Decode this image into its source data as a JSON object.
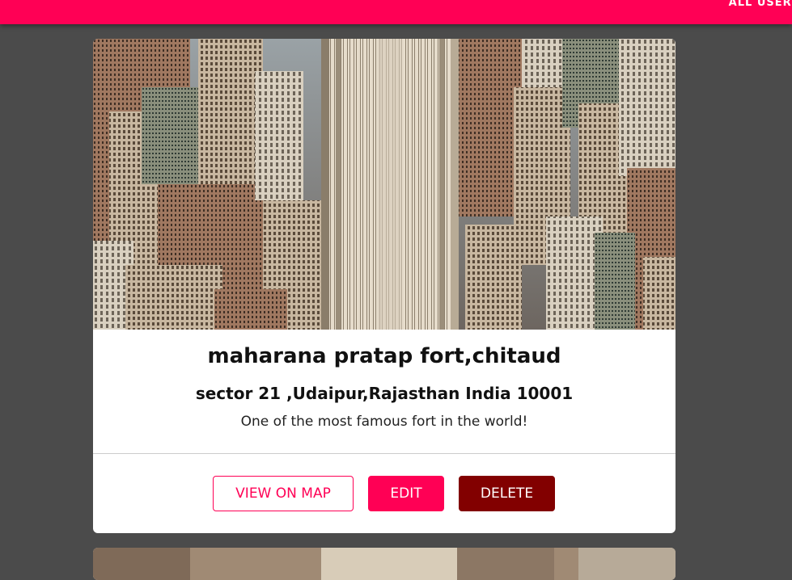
{
  "header": {
    "nav_link_label": "ALL USERS"
  },
  "place": {
    "title": "maharana pratap fort,chitaud",
    "address": "sector 21 ,Udaipur,Rajasthan India 10001",
    "description": "One of the most famous fort in the world!",
    "actions": {
      "view_on_map": "VIEW ON MAP",
      "edit": "EDIT",
      "delete": "DELETE"
    }
  },
  "colors": {
    "accent": "#ff0055",
    "danger": "#820000",
    "background": "#4b4b4b",
    "card": "#ffffff"
  },
  "icons": {
    "place_image": "city-skyline-photo"
  }
}
